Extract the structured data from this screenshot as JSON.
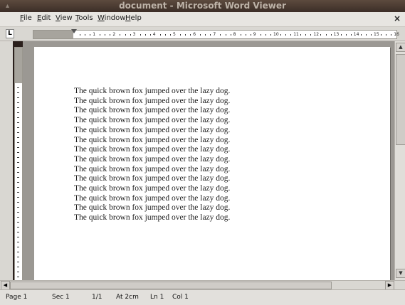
{
  "window": {
    "title": "document - Microsoft Word Viewer",
    "close_glyph": "×"
  },
  "menu": [
    {
      "label": "File",
      "mnemonic": "F",
      "rest": "ile"
    },
    {
      "label": "Edit",
      "mnemonic": "E",
      "rest": "dit"
    },
    {
      "label": "View",
      "mnemonic": "V",
      "rest": "iew"
    },
    {
      "label": "Tools",
      "mnemonic": "T",
      "rest": "ools"
    },
    {
      "label": "Window",
      "mnemonic": "W",
      "rest": "indow"
    },
    {
      "label": "Help",
      "mnemonic": "H",
      "rest": "elp"
    }
  ],
  "ruler": {
    "tab_selector": "L",
    "numbers": [
      "1",
      "2",
      "3",
      "4",
      "5",
      "6",
      "7",
      "8",
      "9",
      "10",
      "11",
      "12",
      "13",
      "14",
      "15",
      "16"
    ]
  },
  "document": {
    "lines": [
      "The quick brown fox jumped over the lazy dog.",
      "The quick brown fox jumped over the lazy dog.",
      "The quick brown fox jumped over the lazy dog.",
      "The quick brown fox jumped over the lazy dog.",
      "The quick brown fox jumped over the lazy dog.",
      "The quick brown fox jumped over the lazy dog.",
      "The quick brown fox jumped over the lazy dog.",
      "The quick brown fox jumped over the lazy dog.",
      "The quick brown fox jumped over the lazy dog.",
      "The quick brown fox jumped over the lazy dog.",
      "The quick brown fox jumped over the lazy dog.",
      "The quick brown fox jumped over the lazy dog.",
      "The quick brown fox jumped over the lazy dog.",
      "The quick brown fox jumped over the lazy dog."
    ]
  },
  "scrollbar": {
    "up_glyph": "▲",
    "down_glyph": "▼",
    "left_glyph": "◀",
    "right_glyph": "▶"
  },
  "status": {
    "page": "Page 1",
    "section": "Sec 1",
    "page_of": "1/1",
    "at": "At 2cm",
    "line": "Ln 1",
    "col": "Col 1"
  }
}
